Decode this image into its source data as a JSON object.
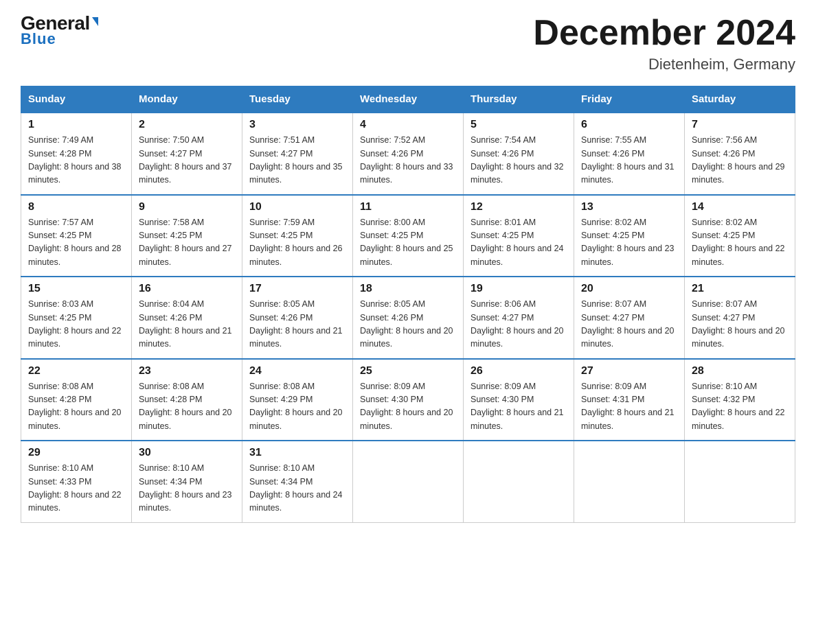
{
  "logo": {
    "general": "General",
    "arrow": "▶",
    "blue": "Blue"
  },
  "title": "December 2024",
  "subtitle": "Dietenheim, Germany",
  "days": [
    "Sunday",
    "Monday",
    "Tuesday",
    "Wednesday",
    "Thursday",
    "Friday",
    "Saturday"
  ],
  "weeks": [
    [
      {
        "num": "1",
        "sunrise": "7:49 AM",
        "sunset": "4:28 PM",
        "daylight": "8 hours and 38 minutes."
      },
      {
        "num": "2",
        "sunrise": "7:50 AM",
        "sunset": "4:27 PM",
        "daylight": "8 hours and 37 minutes."
      },
      {
        "num": "3",
        "sunrise": "7:51 AM",
        "sunset": "4:27 PM",
        "daylight": "8 hours and 35 minutes."
      },
      {
        "num": "4",
        "sunrise": "7:52 AM",
        "sunset": "4:26 PM",
        "daylight": "8 hours and 33 minutes."
      },
      {
        "num": "5",
        "sunrise": "7:54 AM",
        "sunset": "4:26 PM",
        "daylight": "8 hours and 32 minutes."
      },
      {
        "num": "6",
        "sunrise": "7:55 AM",
        "sunset": "4:26 PM",
        "daylight": "8 hours and 31 minutes."
      },
      {
        "num": "7",
        "sunrise": "7:56 AM",
        "sunset": "4:26 PM",
        "daylight": "8 hours and 29 minutes."
      }
    ],
    [
      {
        "num": "8",
        "sunrise": "7:57 AM",
        "sunset": "4:25 PM",
        "daylight": "8 hours and 28 minutes."
      },
      {
        "num": "9",
        "sunrise": "7:58 AM",
        "sunset": "4:25 PM",
        "daylight": "8 hours and 27 minutes."
      },
      {
        "num": "10",
        "sunrise": "7:59 AM",
        "sunset": "4:25 PM",
        "daylight": "8 hours and 26 minutes."
      },
      {
        "num": "11",
        "sunrise": "8:00 AM",
        "sunset": "4:25 PM",
        "daylight": "8 hours and 25 minutes."
      },
      {
        "num": "12",
        "sunrise": "8:01 AM",
        "sunset": "4:25 PM",
        "daylight": "8 hours and 24 minutes."
      },
      {
        "num": "13",
        "sunrise": "8:02 AM",
        "sunset": "4:25 PM",
        "daylight": "8 hours and 23 minutes."
      },
      {
        "num": "14",
        "sunrise": "8:02 AM",
        "sunset": "4:25 PM",
        "daylight": "8 hours and 22 minutes."
      }
    ],
    [
      {
        "num": "15",
        "sunrise": "8:03 AM",
        "sunset": "4:25 PM",
        "daylight": "8 hours and 22 minutes."
      },
      {
        "num": "16",
        "sunrise": "8:04 AM",
        "sunset": "4:26 PM",
        "daylight": "8 hours and 21 minutes."
      },
      {
        "num": "17",
        "sunrise": "8:05 AM",
        "sunset": "4:26 PM",
        "daylight": "8 hours and 21 minutes."
      },
      {
        "num": "18",
        "sunrise": "8:05 AM",
        "sunset": "4:26 PM",
        "daylight": "8 hours and 20 minutes."
      },
      {
        "num": "19",
        "sunrise": "8:06 AM",
        "sunset": "4:27 PM",
        "daylight": "8 hours and 20 minutes."
      },
      {
        "num": "20",
        "sunrise": "8:07 AM",
        "sunset": "4:27 PM",
        "daylight": "8 hours and 20 minutes."
      },
      {
        "num": "21",
        "sunrise": "8:07 AM",
        "sunset": "4:27 PM",
        "daylight": "8 hours and 20 minutes."
      }
    ],
    [
      {
        "num": "22",
        "sunrise": "8:08 AM",
        "sunset": "4:28 PM",
        "daylight": "8 hours and 20 minutes."
      },
      {
        "num": "23",
        "sunrise": "8:08 AM",
        "sunset": "4:28 PM",
        "daylight": "8 hours and 20 minutes."
      },
      {
        "num": "24",
        "sunrise": "8:08 AM",
        "sunset": "4:29 PM",
        "daylight": "8 hours and 20 minutes."
      },
      {
        "num": "25",
        "sunrise": "8:09 AM",
        "sunset": "4:30 PM",
        "daylight": "8 hours and 20 minutes."
      },
      {
        "num": "26",
        "sunrise": "8:09 AM",
        "sunset": "4:30 PM",
        "daylight": "8 hours and 21 minutes."
      },
      {
        "num": "27",
        "sunrise": "8:09 AM",
        "sunset": "4:31 PM",
        "daylight": "8 hours and 21 minutes."
      },
      {
        "num": "28",
        "sunrise": "8:10 AM",
        "sunset": "4:32 PM",
        "daylight": "8 hours and 22 minutes."
      }
    ],
    [
      {
        "num": "29",
        "sunrise": "8:10 AM",
        "sunset": "4:33 PM",
        "daylight": "8 hours and 22 minutes."
      },
      {
        "num": "30",
        "sunrise": "8:10 AM",
        "sunset": "4:34 PM",
        "daylight": "8 hours and 23 minutes."
      },
      {
        "num": "31",
        "sunrise": "8:10 AM",
        "sunset": "4:34 PM",
        "daylight": "8 hours and 24 minutes."
      },
      null,
      null,
      null,
      null
    ]
  ]
}
